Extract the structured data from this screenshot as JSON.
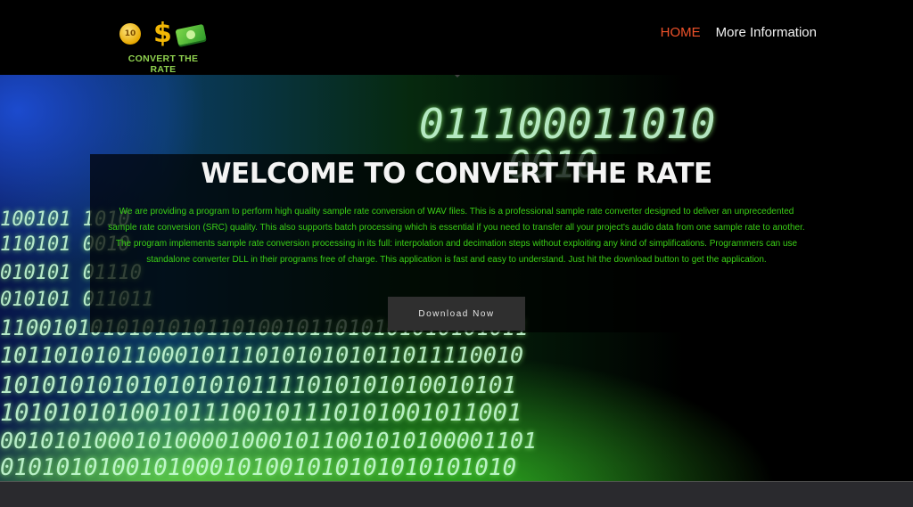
{
  "header": {
    "logo": {
      "coin_label": "10",
      "dollar_glyph": "$",
      "text": "CONVERT THE RATE"
    },
    "nav": [
      {
        "label": "HOME",
        "active": true
      },
      {
        "label": "More Information",
        "active": false
      }
    ]
  },
  "hero": {
    "title": "WELCOME TO CONVERT THE RATE",
    "description": "We are providing a program to perform high quality sample rate conversion of WAV files. This is a professional sample rate converter designed to deliver an unprecedented sample rate conversion (SRC) quality. This also supports batch processing which is essential if you need to transfer all your project's audio data from one sample rate to another. The program implements sample rate conversion processing in its full: interpolation and decimation steps without exploiting any kind of simplifications. Programmers can use standalone converter DLL in their programs free of charge. This application is fast and easy to understand. Just hit the download button to get the application.",
    "download_label": "Download Now",
    "binary_rows": [
      "                                       011100011010",
      "                                                   0010",
      "100101                                              1010",
      "110101                                             0010",
      "010101                                            01110",
      "010101                                           011011",
      "11001010101010101101001011010101010101011",
      "101101010110001011101010101011011110010",
      "1010101010101010101111010101010010101",
      "101010101001011100101110101001011001",
      "0010101000101000010001011001010100001101",
      "0101010100101000101001010101010101010"
    ]
  },
  "colors": {
    "accent": "#f0522a",
    "title_text": "#f4f4f4",
    "body_text": "#3bd116",
    "button_bg": "#2f2f2f"
  }
}
